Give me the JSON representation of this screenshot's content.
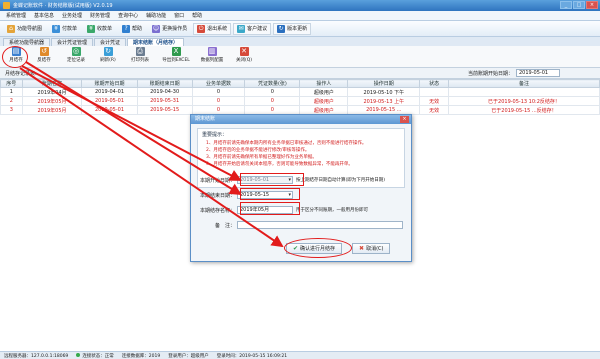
{
  "window": {
    "title": "金蝶记账软件 · 财务结账版(试用版) V2.0.19",
    "min": "_",
    "max": "□",
    "close": "×"
  },
  "menu": [
    "系统管理",
    "基本信息",
    "业务处理",
    "财务管理",
    "查询中心",
    "辅助功能",
    "窗口",
    "帮助"
  ],
  "toolbar1": [
    {
      "label": "功能导航图",
      "icon": "house-icon",
      "color": "#e4a43a",
      "glyph": "⌂"
    },
    {
      "label": "付款单",
      "icon": "payment-icon",
      "color": "#3b8fd8",
      "glyph": "¥"
    },
    {
      "label": "收款单",
      "icon": "receipt-icon",
      "color": "#3aa86a",
      "glyph": "¥"
    },
    {
      "label": "帮助",
      "icon": "help-icon",
      "color": "#2f7fd0",
      "glyph": "?"
    },
    {
      "label": "更换操作员",
      "icon": "user-switch-icon",
      "color": "#7a6fd0",
      "glyph": "☺"
    },
    {
      "label": "退出系统",
      "icon": "exit-icon",
      "color": "#d64a3a",
      "glyph": "⏻"
    },
    {
      "label": "客户建议",
      "icon": "suggest-icon",
      "color": "#3aa8c9",
      "glyph": "✉"
    },
    {
      "label": "版本更新",
      "icon": "update-icon",
      "color": "#2a6fbf",
      "glyph": "↻"
    }
  ],
  "tabs": [
    {
      "label": "系统功能导航器",
      "active": false
    },
    {
      "label": "会计凭证管理",
      "active": false
    },
    {
      "label": "会计凭证",
      "active": false
    },
    {
      "label": "期末结账（月结存）",
      "active": true
    }
  ],
  "toolbar2": [
    {
      "label": "月结存",
      "icon": "month-close-icon",
      "color": "#3a7fcf",
      "glyph": "▤"
    },
    {
      "label": "反结存",
      "icon": "reverse-close-icon",
      "color": "#e08a2a",
      "glyph": "↺"
    },
    {
      "label": "定位记录",
      "icon": "locate-icon",
      "color": "#3aa86a",
      "glyph": "◎"
    },
    {
      "label": "刷新(R)",
      "icon": "refresh-icon",
      "color": "#3a9fd8",
      "glyph": "↻"
    },
    {
      "label": "打印列表",
      "icon": "print-icon",
      "color": "#6b7d91",
      "glyph": "⎙"
    },
    {
      "label": "导出到EXCEL",
      "icon": "excel-icon",
      "color": "#2f9a4e",
      "glyph": "X"
    },
    {
      "label": "数据列配置",
      "icon": "columns-icon",
      "color": "#8a6fd0",
      "glyph": "▥"
    },
    {
      "label": "关闭(Q)",
      "icon": "close-icon",
      "color": "#d64a3a",
      "glyph": "✕"
    }
  ],
  "filter": {
    "left_label": "月结存记录表:",
    "right_label": "当前账期开始日期：",
    "right_value": "2019-05-01"
  },
  "table": {
    "headers": [
      "序号",
      "账期名称",
      "账期开始日期",
      "账期结束日期",
      "业务单据数",
      "凭证数量(张)",
      "操作人",
      "操作日期",
      "状态",
      "备注"
    ],
    "rows": [
      {
        "cells": [
          "1",
          "2019年04月",
          "2019-04-01",
          "2019-04-30",
          "0",
          "0",
          "超级用户",
          "2019-05-10 下午",
          "",
          ""
        ],
        "red": false
      },
      {
        "cells": [
          "2",
          "2019年05月",
          "2019-05-01",
          "2019-05-31",
          "0",
          "0",
          "超级用户",
          "2019-05-13 上午",
          "无效",
          "已于2019-05-13 10:2反结存！"
        ],
        "red": true
      },
      {
        "cells": [
          "3",
          "2019年05月",
          "2019-05-01",
          "2019-05-15",
          "0",
          "0",
          "超级用户",
          "2019-05-15 ...",
          "无效",
          "已于2019-05-15 ...反结存！"
        ],
        "red": true
      }
    ]
  },
  "dialog": {
    "title": "期末结账",
    "close": "×",
    "tips_title": "重要提示：",
    "tips": [
      "1、月结存前请先确保本期内所有业务单据已审核通过，否则不能进行结存操作。",
      "2、月结存后的业务单据不能进行修改/审核等操作。",
      "3、月结存前请先确保所有单据已整理好作为业务单据。",
      "4、月结存开始后请勿关闭本程序，否则可能导致数据异常，不能再开单。"
    ],
    "period_start_label": "本期开始日期：",
    "period_start_value": "2019-05-01",
    "period_start_note": "按上期结存日期自动计算(即为下月开始日期)",
    "period_end_label": "本期结束日期：",
    "period_end_value": "2019-05-15",
    "period_name_label": "本期结存名称：",
    "period_name_value": "2019年05月",
    "period_name_note": "用于区分不同账期，一般用月份即可",
    "remark_label": "备　注：",
    "remark_value": "",
    "confirm_label": "确认进行月结存",
    "cancel_label": "取消(C)"
  },
  "statusbar": {
    "server": "远程服务器：127.0.0.1:18069",
    "conn": "连接状态：正常",
    "db": "连接数据库：2019",
    "user": "登录用户：超级用户",
    "login_time": "登录时间：2019-05-15 16:09:21"
  },
  "highlight_color": "#e21b1b"
}
